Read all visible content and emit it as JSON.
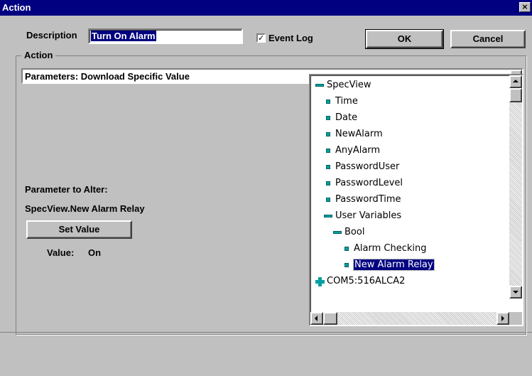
{
  "window": {
    "title": "Action",
    "close_glyph": "×"
  },
  "description": {
    "label": "Description",
    "value": "Turn On Alarm"
  },
  "event_log": {
    "label": "Event Log",
    "checked": true,
    "check_glyph": "✓"
  },
  "buttons": {
    "ok": "OK",
    "cancel": "Cancel",
    "set_value": "Set Value"
  },
  "action_group": {
    "label": "Action"
  },
  "action_combo": {
    "selected": "Parameters: Download Specific Value"
  },
  "parameter": {
    "label": "Parameter to Alter:",
    "path": "SpecView.New Alarm Relay",
    "value_label": "Value:",
    "value": "On"
  },
  "tree": {
    "nodes": [
      {
        "label": "SpecView",
        "icon": "minus-icon",
        "level": 0
      },
      {
        "label": "Time",
        "icon": "leaf-icon",
        "level": 1
      },
      {
        "label": "Date",
        "icon": "leaf-icon",
        "level": 1
      },
      {
        "label": "NewAlarm",
        "icon": "leaf-icon",
        "level": 1
      },
      {
        "label": "AnyAlarm",
        "icon": "leaf-icon",
        "level": 1
      },
      {
        "label": "PasswordUser",
        "icon": "leaf-icon",
        "level": 1
      },
      {
        "label": "PasswordLevel",
        "icon": "leaf-icon",
        "level": 1
      },
      {
        "label": "PasswordTime",
        "icon": "leaf-icon",
        "level": 1
      },
      {
        "label": "User Variables",
        "icon": "minus-icon",
        "level": 1
      },
      {
        "label": "Bool",
        "icon": "minus-icon",
        "level": 2
      },
      {
        "label": "Alarm Checking",
        "icon": "leaf-icon",
        "level": 3
      },
      {
        "label": "New Alarm Relay",
        "icon": "leaf-icon",
        "level": 3,
        "selected": true
      },
      {
        "label": "COM5:516ALCA2",
        "icon": "plus-icon",
        "level": 0
      }
    ]
  },
  "colors": {
    "titlebar": "#000080",
    "face": "#c0c0c0",
    "tree_icon": "#00a0a0"
  }
}
